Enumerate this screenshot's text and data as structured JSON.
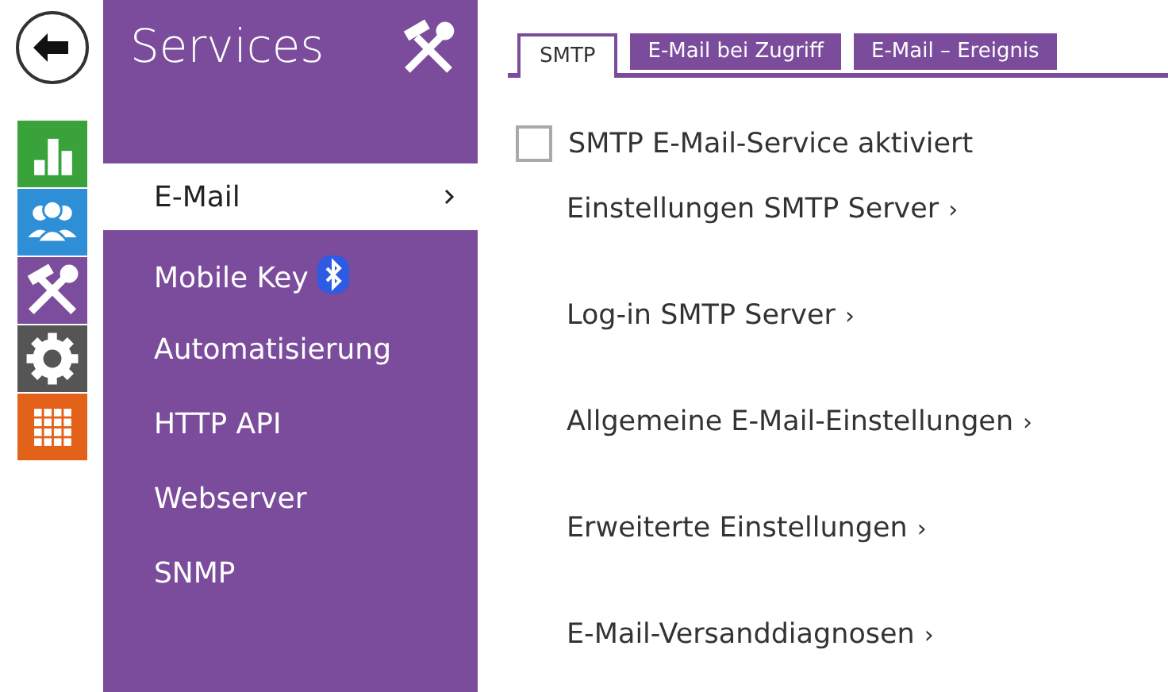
{
  "rail": [
    {
      "kind": "back"
    },
    {
      "kind": "chart",
      "color": "#3aa23a"
    },
    {
      "kind": "users",
      "color": "#2e8fd6"
    },
    {
      "kind": "tools",
      "color": "#7c4d9c"
    },
    {
      "kind": "gear",
      "color": "#555555"
    },
    {
      "kind": "apps",
      "color": "#e2621a"
    }
  ],
  "sidebar": {
    "title": "Services",
    "items": [
      {
        "label": "E-Mail",
        "selected": true
      },
      {
        "label": "Mobile Key",
        "selected": false,
        "bluetooth": true
      },
      {
        "label": "Automatisierung",
        "selected": false
      },
      {
        "label": "HTTP API",
        "selected": false
      },
      {
        "label": "Webserver",
        "selected": false
      },
      {
        "label": "SNMP",
        "selected": false
      }
    ]
  },
  "tabs": [
    {
      "label": "SMTP",
      "selected": true
    },
    {
      "label": "E-Mail bei Zugriff",
      "selected": false
    },
    {
      "label": "E-Mail – Ereignis",
      "selected": false
    }
  ],
  "checkbox": {
    "label": "SMTP E-Mail-Service aktiviert",
    "checked": false
  },
  "links": [
    {
      "label": "Einstellungen SMTP Server",
      "arrow": "›"
    },
    {
      "label": "Log-in SMTP Server",
      "arrow": "›"
    },
    {
      "label": "Allgemeine E-Mail-Einstellungen",
      "arrow": "›"
    },
    {
      "label": "Erweiterte Einstellungen",
      "arrow": "›"
    },
    {
      "label": "E-Mail-Versanddiagnosen",
      "arrow": "›"
    }
  ]
}
